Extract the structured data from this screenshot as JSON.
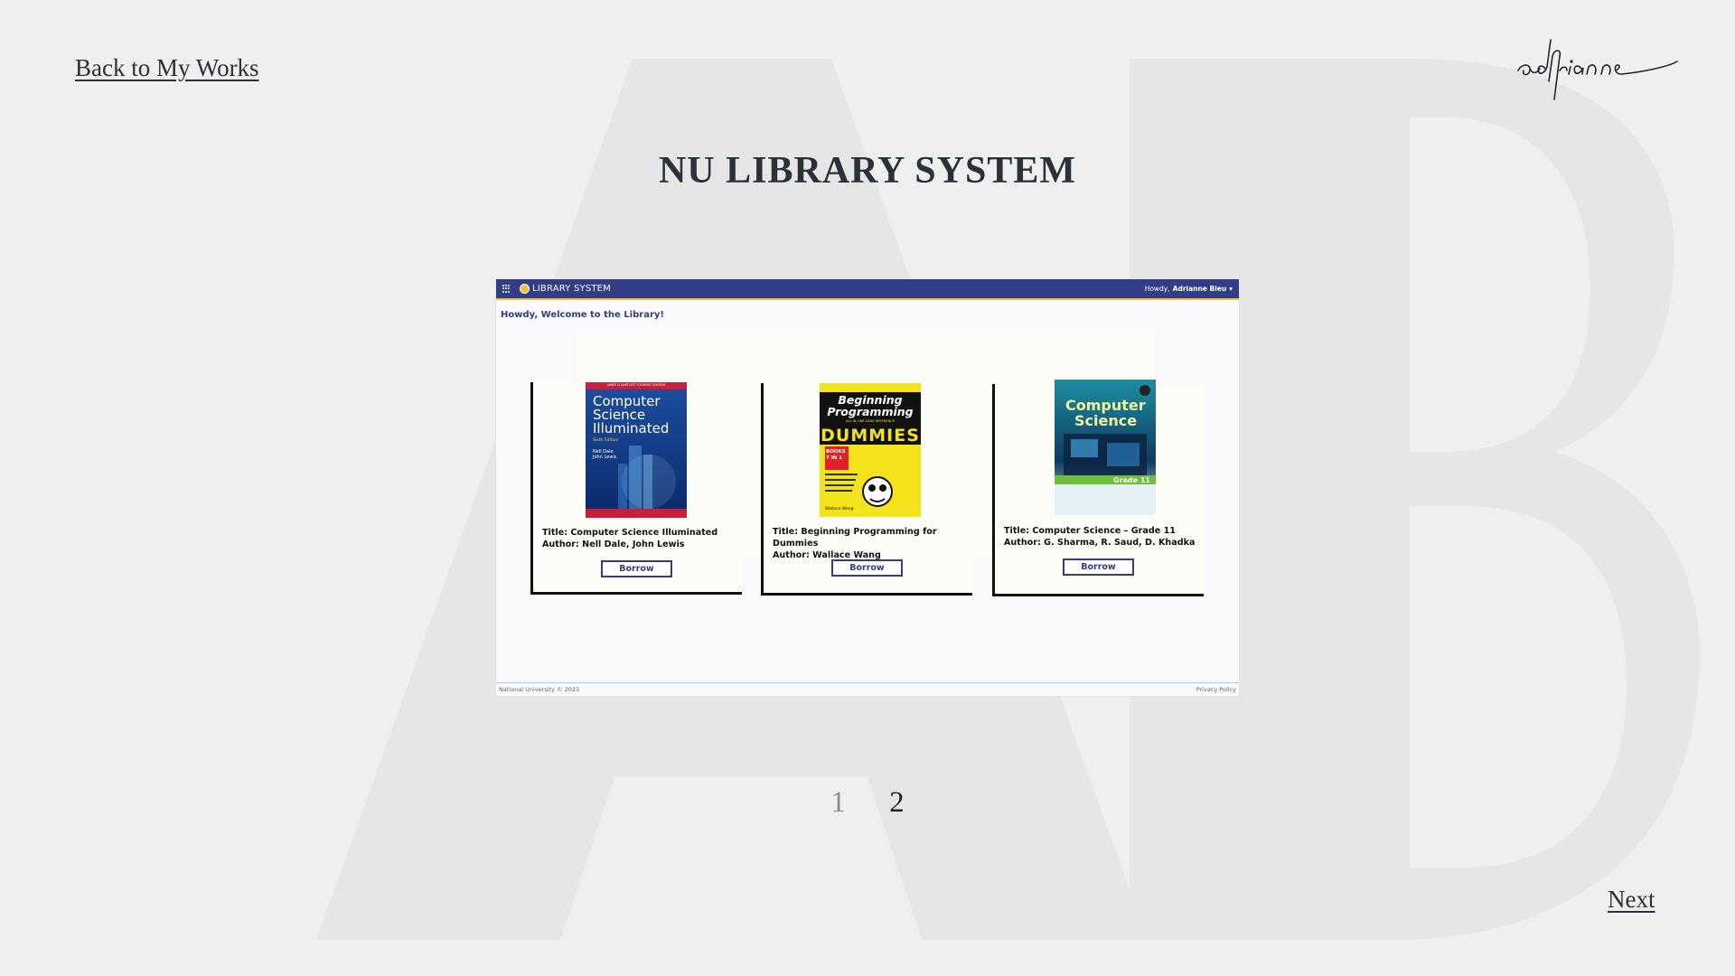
{
  "nav": {
    "back_label": "Back to My Works",
    "next_label": "Next"
  },
  "brand": {
    "signature_text": "adrianne"
  },
  "page": {
    "title": "NU LIBRARY SYSTEM"
  },
  "screenshot": {
    "app_title": "LIBRARY SYSTEM",
    "greeting_prefix": "Howdy,",
    "user_name": "Adrianne Bleu",
    "welcome": "Howdy, Welcome to the Library!",
    "books": [
      {
        "title": "Title: Computer Science Illuminated",
        "author": "Author: Nell Dale, John Lewis",
        "borrow": "Borrow",
        "cover_top": "JONES & BARTLETT STUDENT EDITION",
        "cover_title": [
          "Computer",
          "Science",
          "Illuminated"
        ],
        "cover_sub": "Sixth Edition",
        "cover_authors": [
          "Nell Dale",
          "John Lewis"
        ]
      },
      {
        "title": "Title: Beginning Programming for Dummies",
        "author": "Author: Wallace Wang",
        "borrow": "Borrow",
        "cover_title": [
          "Beginning",
          "Programming"
        ],
        "cover_sub": "ALL-IN-ONE DESK REFERENCE",
        "cover_brand": "DUMMIES",
        "cover_badge": "BOOKS 7 IN 1",
        "cover_author": "Wallace Wang"
      },
      {
        "title": "Title: Computer Science – Grade 11",
        "author": "Author: G. Sharma, R. Saud, D. Khadka",
        "borrow": "Borrow",
        "cover_title": [
          "Computer",
          "Science"
        ],
        "cover_sub": "Grade 11"
      }
    ],
    "footer_left": "National University © 2023",
    "footer_right": "Privacy Policy"
  },
  "pagination": {
    "pages": [
      "1",
      "2"
    ],
    "current": "2"
  },
  "colors": {
    "app_bar": "#333d87",
    "app_bar_accent": "#f1c232",
    "background": "#efefef",
    "text": "#2b3138"
  }
}
